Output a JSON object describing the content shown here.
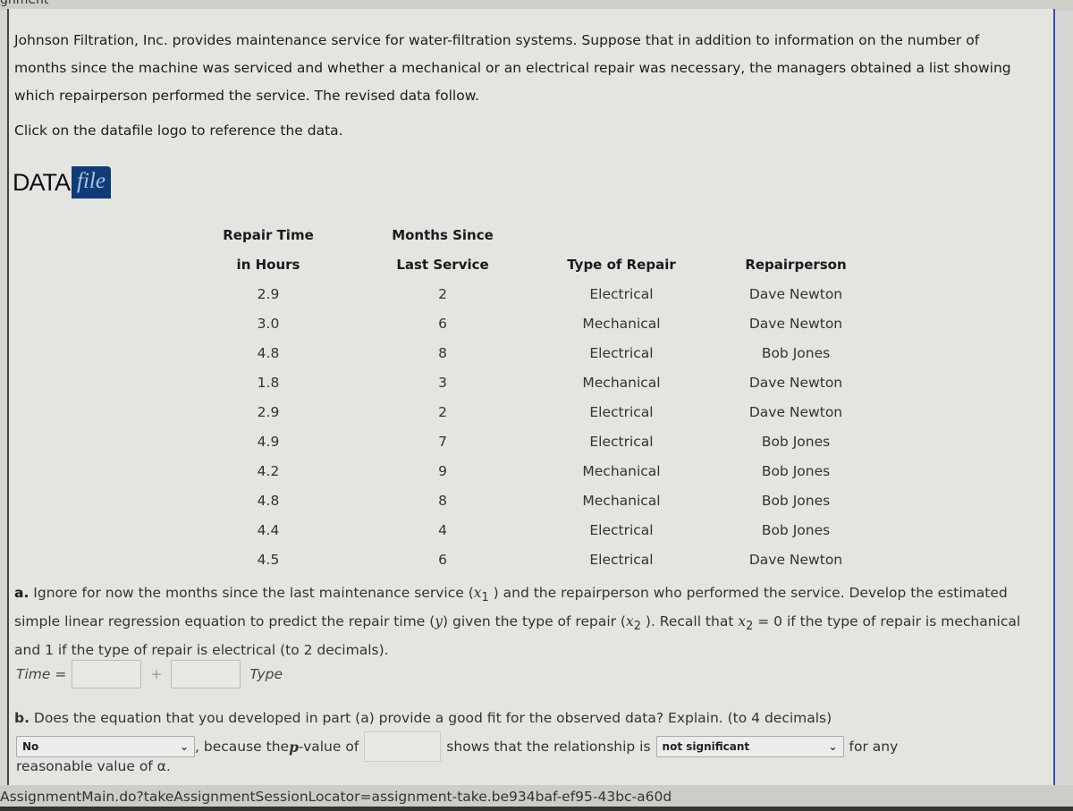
{
  "page_header_fragment": "gnment",
  "intro_text": "Johnson Filtration, Inc. provides maintenance service for water-filtration systems. Suppose that in addition to information on the number of months since the machine was serviced and whether a mechanical or an electrical repair was necessary, the managers obtained a list showing which repairperson performed the service. The revised data follow.",
  "click_note": "Click on the datafile logo to reference the data.",
  "datafile_logo": {
    "data_word": "DATA",
    "file_word": "file",
    "color": "#0f3c78"
  },
  "table": {
    "headers_top": [
      "Repair Time",
      "Months Since",
      "",
      ""
    ],
    "headers_bottom": [
      "in Hours",
      "Last Service",
      "Type of Repair",
      "Repairperson"
    ],
    "rows": [
      [
        "2.9",
        "2",
        "Electrical",
        "Dave Newton"
      ],
      [
        "3.0",
        "6",
        "Mechanical",
        "Dave Newton"
      ],
      [
        "4.8",
        "8",
        "Electrical",
        "Bob Jones"
      ],
      [
        "1.8",
        "3",
        "Mechanical",
        "Dave Newton"
      ],
      [
        "2.9",
        "2",
        "Electrical",
        "Dave Newton"
      ],
      [
        "4.9",
        "7",
        "Electrical",
        "Bob Jones"
      ],
      [
        "4.2",
        "9",
        "Mechanical",
        "Bob Jones"
      ],
      [
        "4.8",
        "8",
        "Mechanical",
        "Bob Jones"
      ],
      [
        "4.4",
        "4",
        "Electrical",
        "Bob Jones"
      ],
      [
        "4.5",
        "6",
        "Electrical",
        "Dave Newton"
      ]
    ]
  },
  "part_a": {
    "label": "a.",
    "text1": "Ignore for now the months since the last maintenance service (",
    "x1": "x",
    "x1_sub": "1",
    "text2": " ) and the repairperson who performed the service. Develop the estimated simple linear regression equation to predict the repair time (",
    "y": "y",
    "text3": ") given the type of repair (",
    "x2": "x",
    "x2_sub": "2",
    "text4": " ). Recall that ",
    "x2b": "x",
    "x2b_sub": "2",
    "text5": " = 0 if the type of repair is mechanical and 1 if the type of repair is electrical (to 2 decimals).",
    "eq_lhs": "Time =",
    "plus": "+",
    "eq_rhs": "Type",
    "intercept_value": "",
    "slope_value": ""
  },
  "part_b": {
    "label": "b.",
    "text": "Does the equation that you developed in part (a) provide a good fit for the observed data? Explain. (to 4 decimals)",
    "fit_select": "No",
    "because": ", because the ",
    "p": "p",
    "pvalue_of": "-value of",
    "pvalue": "",
    "shows": "shows that the relationship is",
    "significance_select": "not significant",
    "for_any": "for any",
    "reasonable": "reasonable value of α."
  },
  "status_url": "AssignmentMain.do?takeAssignmentSessionLocator=assignment-take.be934baf-ef95-43bc-a60d"
}
